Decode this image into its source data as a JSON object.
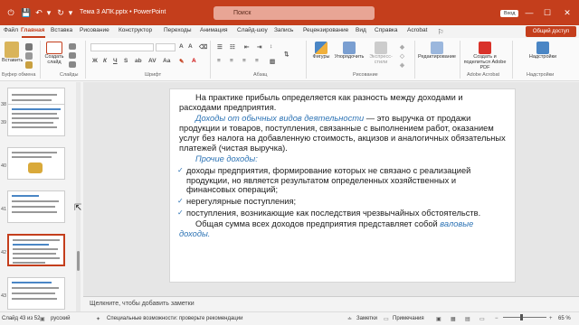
{
  "titlebar": {
    "autosave_icon": "toggle-icon",
    "doc_title": "Тема 3 АПК.pptx",
    "separator": "•",
    "app_name": "PowerPoint",
    "search_placeholder": "Поиск",
    "signin": "Вход",
    "minimize": "—",
    "maximize": "☐",
    "close": "✕"
  },
  "tabs": [
    "Файл",
    "Главная",
    "Вставка",
    "Рисование",
    "Конструктор",
    "Переходы",
    "Анимация",
    "Слайд-шоу",
    "Запись",
    "Рецензирование",
    "Вид",
    "Справка",
    "Acrobat"
  ],
  "share_label": "Общий доступ",
  "ribbon": {
    "paste": "Вставить",
    "clipboard_group": "Буфер обмена",
    "new_slide": "Создать слайд",
    "slides_group": "Слайды",
    "font_group": "Шрифт",
    "paragraph_group": "Абзац",
    "shapes": "Фигуры",
    "arrange": "Упорядочить",
    "quick_styles": "Экспресс-стили",
    "drawing_group": "Рисование",
    "editing": "Редактирование",
    "create_share_pdf": "Создать и поделиться Adobe PDF",
    "adobe_group": "Adobe Acrobat",
    "addins": "Надстройки",
    "addins_group": "Надстройки"
  },
  "thumbs": [
    "38",
    "39",
    "40",
    "41",
    "42",
    "43"
  ],
  "slide": {
    "p1": "На практике прибыль определяется как разность между доходами и расходами предприятия.",
    "p2_em": "Доходы от обычных видов деятельности",
    "p2_rest": " — это выручка от продажи продукции и товаров, поступления, связанные с выполнением работ, оказанием услуг без налога на добавленную стоимость, акцизов и аналогичных обязательных платежей (чистая выручка).",
    "p3_em": "Прочие доходы:",
    "b1": "доходы предприятия, формирование которых не связано с реализацией продукции, но является результатом определенных хозяйственных и финансовых операций;",
    "b2": "нерегулярные поступления;",
    "b3": "поступления, возникающие как последствия чрезвычайных обстоятельств.",
    "p4": "Общая сумма всех доходов предприятия представляет собой ",
    "p4_em": "валовые доходы."
  },
  "notes_placeholder": "Щелкните, чтобы добавить заметки",
  "status": {
    "slide_counter": "Слайд 43 из 52",
    "language": "русский",
    "accessibility": "Специальные возможности: проверьте рекомендации",
    "notes": "Заметки",
    "comments": "Примечания",
    "zoom": "65 %"
  },
  "colors": {
    "accent": "#c43e1c",
    "emphasis": "#2e74b5"
  }
}
